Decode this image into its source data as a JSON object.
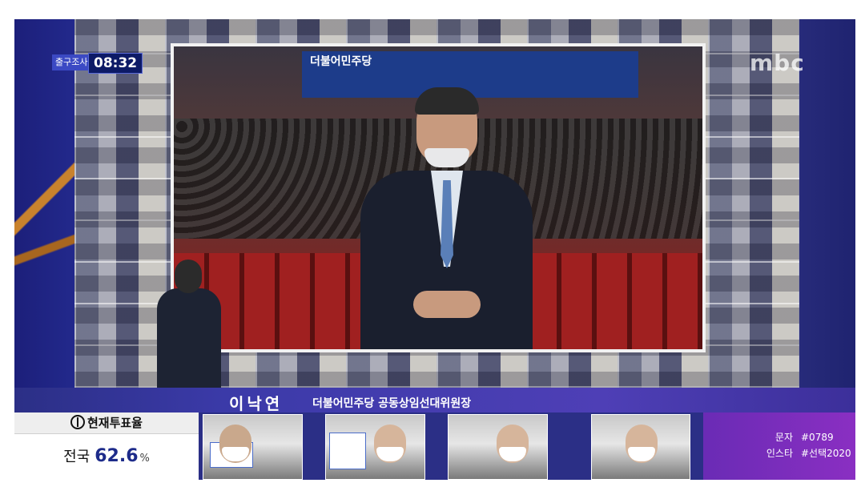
{
  "broadcast": {
    "exit_poll_label": "출구조사",
    "clock": "08:32",
    "channel_logo": "mbc"
  },
  "stage": {
    "banner_text": "더불어민주당"
  },
  "lower_third": {
    "name": "이낙연",
    "title": "더불어민주당 공동상임선대위원장"
  },
  "turnout": {
    "header": "현재투표율",
    "region": "전국",
    "value": "62.6",
    "unit": "%"
  },
  "sms_box": {
    "rows": [
      {
        "label": "문자",
        "value": "#0789"
      },
      {
        "label": "인스타",
        "value": "#선택2020"
      }
    ]
  },
  "colors": {
    "accent_blue": "#2b2f86",
    "purple": "#8a2fc2",
    "turnout_value": "#1d2b8a"
  }
}
